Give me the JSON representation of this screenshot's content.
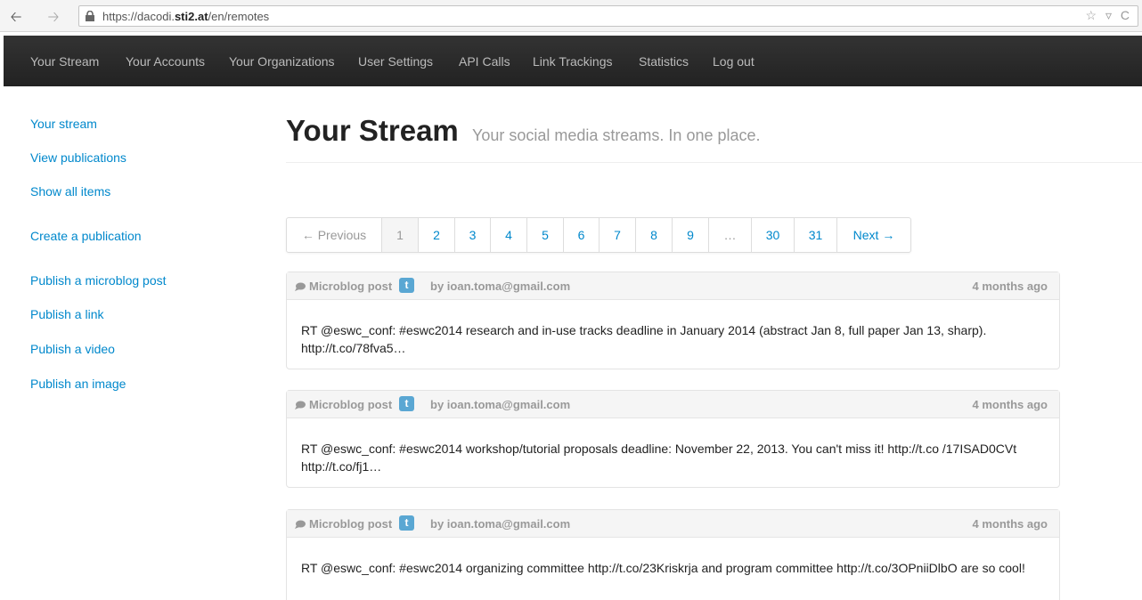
{
  "browser": {
    "url_prefix": "https://dacodi.",
    "url_domain": "sti2.at",
    "url_path": "/en/remotes",
    "back_icon": "arrow-left-icon",
    "forward_icon": "arrow-right-icon",
    "actions_text": "☆ ▿ C"
  },
  "navbar": {
    "items": [
      {
        "label": "Your Stream"
      },
      {
        "label": "Your Accounts"
      },
      {
        "label": "Your Organizations"
      },
      {
        "label": "User Settings"
      },
      {
        "label": "API Calls"
      },
      {
        "label": "Link Trackings"
      },
      {
        "label": "Statistics"
      },
      {
        "label": "Log out"
      }
    ]
  },
  "sidebar": {
    "items": [
      {
        "label": "Your stream"
      },
      {
        "label": "View publications"
      },
      {
        "label": "Show all items"
      },
      {
        "label": "Create a publication"
      },
      {
        "label": "Publish a microblog post"
      },
      {
        "label": "Publish a link"
      },
      {
        "label": "Publish a video"
      },
      {
        "label": "Publish an image"
      }
    ]
  },
  "header": {
    "title": "Your Stream",
    "subtitle": "Your social media streams. In one place."
  },
  "pagination": {
    "previous": "← Previous",
    "pages": [
      "1",
      "2",
      "3",
      "4",
      "5",
      "6",
      "7",
      "8",
      "9",
      "…",
      "30",
      "31"
    ],
    "current_page": "1",
    "next": "Next →"
  },
  "posts": [
    {
      "type": "Microblog post",
      "network_icon": "twitter-icon",
      "network_glyph": "t",
      "author": "by ioan.toma@gmail.com",
      "time": "4 months ago",
      "text": "RT @eswc_conf: #eswc2014 research and in-use tracks deadline in January 2014 (abstract Jan 8, full paper Jan 13, sharp). http://t.co/78fva5…"
    },
    {
      "type": "Microblog post",
      "network_icon": "twitter-icon",
      "network_glyph": "t",
      "author": "by ioan.toma@gmail.com",
      "time": "4 months ago",
      "text": "RT @eswc_conf: #eswc2014 workshop/tutorial proposals deadline: November 22, 2013. You can't miss it! http://t.co /17ISAD0CVt http://t.co/fj1…"
    },
    {
      "type": "Microblog post",
      "network_icon": "twitter-icon",
      "network_glyph": "t",
      "author": "by ioan.toma@gmail.com",
      "time": "4 months ago",
      "text": "RT @eswc_conf: #eswc2014 organizing committee http://t.co/23Kriskrja and program committee http://t.co/3OPniiDlbO are so cool!"
    }
  ]
}
